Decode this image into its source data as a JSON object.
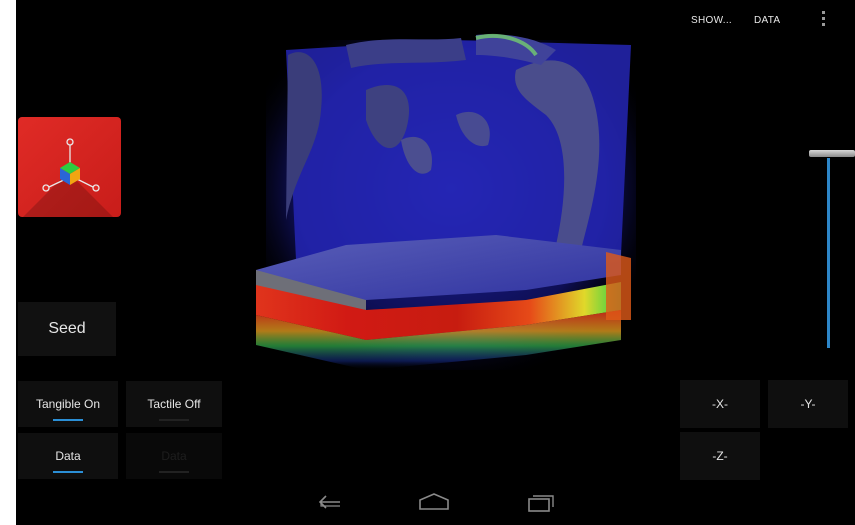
{
  "action_bar": {
    "show_label": "SHOW...",
    "data_label": "DATA"
  },
  "left_panel": {
    "seed_label": "Seed",
    "tangible_label": "Tangible On",
    "tactile_label": "Tactile Off",
    "data_label": "Data",
    "data2_label": "Data"
  },
  "axis_buttons": {
    "x_label": "-X-",
    "y_label": "-Y-",
    "z_label": "-Z-"
  },
  "colors": {
    "accent": "#2b8fd6",
    "tile": "#e02b26",
    "background": "#000000"
  },
  "icons": {
    "app": "axes-cube-icon",
    "back": "back-icon",
    "home": "home-icon",
    "recents": "recents-icon",
    "overflow": "overflow-menu-icon"
  }
}
